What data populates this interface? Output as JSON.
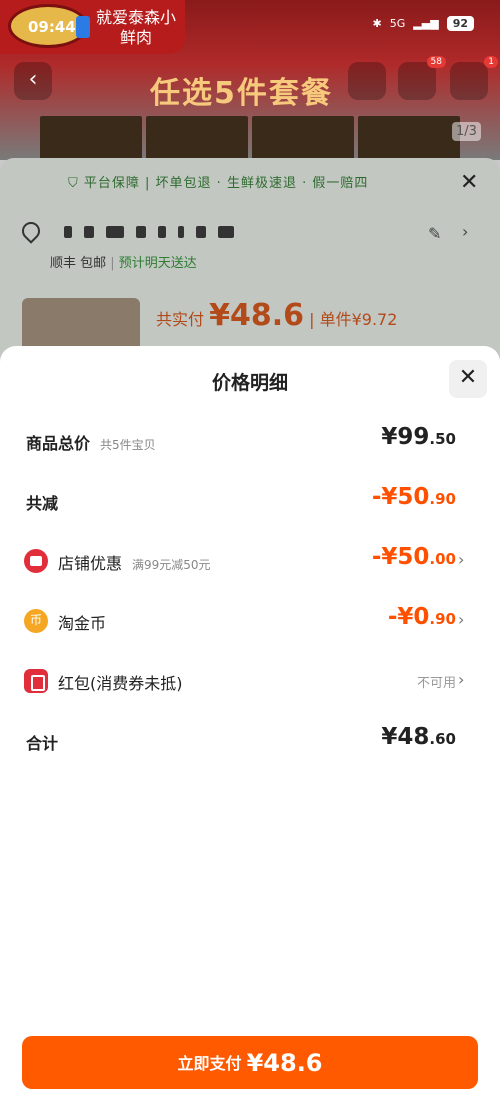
{
  "status_bar": {
    "time": "09:44",
    "battery": "92",
    "network": "5G"
  },
  "store": {
    "name": "就爱泰森小鲜肉"
  },
  "background": {
    "banner_title": "任选5件套餐",
    "page_indicator": "1/3",
    "cart_badge": "58",
    "more_badge": "1",
    "guarantee": "平台保障 | 坏单包退 · 生鲜极速退 · 假一赔四",
    "shipping": "顺丰 包邮",
    "delivery": "预计明天送达",
    "paid_label": "共实付",
    "paid_amount": "¥48.6",
    "unit_price": "单件¥9.72"
  },
  "modal": {
    "title": "价格明细",
    "rows": [
      {
        "label": "商品总价",
        "sub": "共5件宝贝",
        "value_main": "¥99",
        "value_dec": ".50"
      },
      {
        "label": "共减",
        "sub": "",
        "value_main": "-¥50",
        "value_dec": ".90"
      },
      {
        "label": "店铺优惠",
        "sub": "满99元减50元",
        "value_main": "-¥50",
        "value_dec": ".00"
      },
      {
        "label": "淘金币",
        "sub": "",
        "value_main": "-¥0",
        "value_dec": ".90"
      },
      {
        "label": "红包(消费券未抵)",
        "sub": "",
        "value": "不可用"
      },
      {
        "label": "合计",
        "sub": "",
        "value_main": "¥48",
        "value_dec": ".60"
      }
    ]
  },
  "pay_button": {
    "label": "立即支付",
    "amount": "¥48.6"
  },
  "colors": {
    "accent": "#ff5000",
    "button": "#ff5a00",
    "shop_icon": "#e02e3a",
    "coin_icon": "#f5a623"
  }
}
